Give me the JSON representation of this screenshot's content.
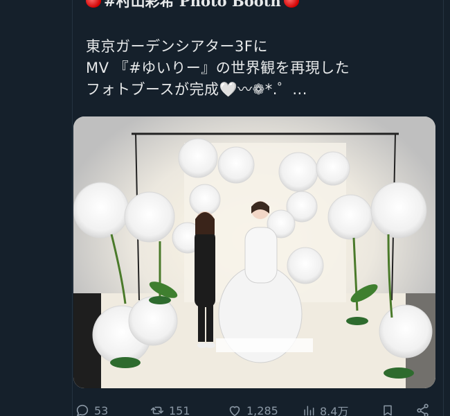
{
  "tweet": {
    "header_text": "#村山彩希 Photo Booth",
    "header_emoji": "red-heart-emoji",
    "text_lines": [
      "東京ガーデンシアター3Fに",
      "MV 『#ゆいりー』の世界観を再現した",
      "フォトブースが完成🤍〰❁*.゜..."
    ],
    "media": {
      "icon": "photo",
      "description_visible": false
    }
  },
  "actions": {
    "reply_count": "53",
    "retweet_count": "151",
    "like_count": "1,285",
    "views_count": "8.4万",
    "icons": [
      "reply-icon",
      "retweet-icon",
      "like-icon",
      "views-icon",
      "bookmark-icon",
      "share-icon"
    ]
  },
  "colors": {
    "background": "#15202b",
    "text": "#e7e9ea",
    "muted": "#8b98a5",
    "divider": "#253341"
  }
}
